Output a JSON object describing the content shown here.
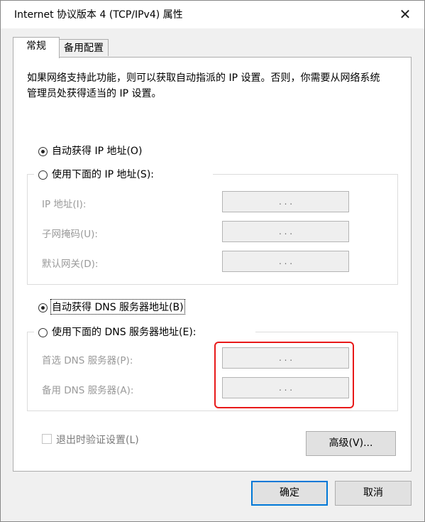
{
  "window": {
    "title": "Internet 协议版本 4 (TCP/IPv4) 属性",
    "close_glyph": "✕"
  },
  "tabs": {
    "general": "常规",
    "alternate": "备用配置"
  },
  "description": "如果网络支持此功能，则可以获取自动指派的 IP 设置。否则，你需要从网络系统管理员处获得适当的 IP 设置。",
  "ip": {
    "auto_label": "自动获得 IP 地址(O)",
    "manual_label": "使用下面的 IP 地址(S):",
    "auto_selected": true,
    "fields": [
      {
        "label": "IP 地址(I):",
        "value": ".   .   ."
      },
      {
        "label": "子网掩码(U):",
        "value": ".   .   ."
      },
      {
        "label": "默认网关(D):",
        "value": ".   .   ."
      }
    ]
  },
  "dns": {
    "auto_label": "自动获得 DNS 服务器地址(B)",
    "manual_label": "使用下面的 DNS 服务器地址(E):",
    "auto_selected": true,
    "fields": [
      {
        "label": "首选 DNS 服务器(P):",
        "value": ".   .   ."
      },
      {
        "label": "备用 DNS 服务器(A):",
        "value": ".   .   ."
      }
    ]
  },
  "validate_label": "退出时验证设置(L)",
  "buttons": {
    "advanced": "高级(V)...",
    "ok": "确定",
    "cancel": "取消"
  },
  "colors": {
    "highlight": "#e81919",
    "accent": "#0078d7"
  }
}
